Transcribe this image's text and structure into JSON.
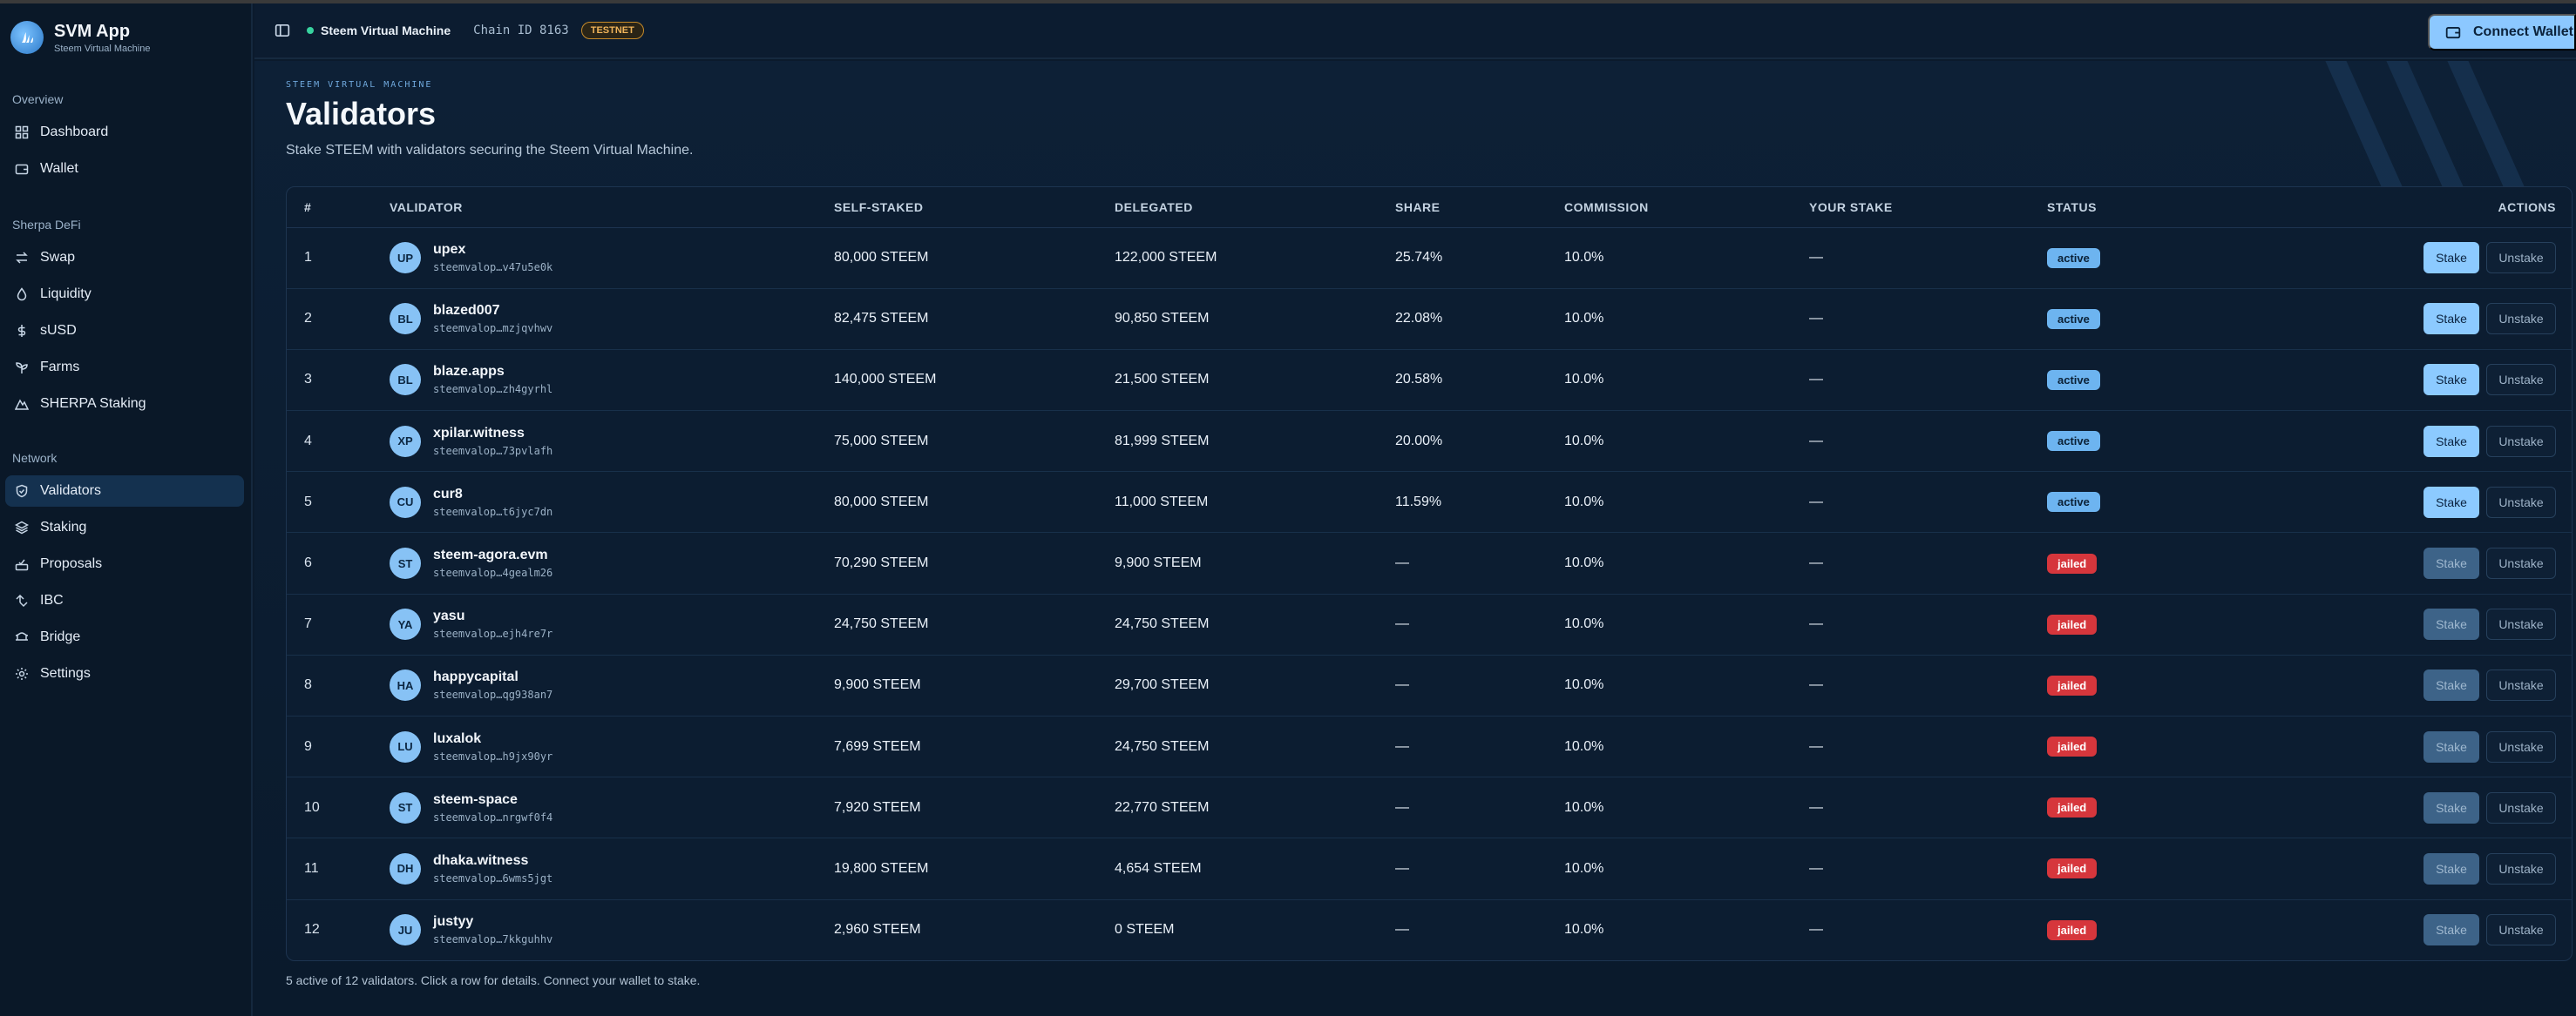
{
  "brand": {
    "title": "SVM App",
    "subtitle": "Steem Virtual Machine"
  },
  "sidebar": {
    "sections": [
      {
        "label": "Overview",
        "items": [
          {
            "label": "Dashboard",
            "icon": "grid-icon"
          },
          {
            "label": "Wallet",
            "icon": "wallet-icon"
          }
        ]
      },
      {
        "label": "Sherpa DeFi",
        "items": [
          {
            "label": "Swap",
            "icon": "swap-icon"
          },
          {
            "label": "Liquidity",
            "icon": "droplet-icon"
          },
          {
            "label": "sUSD",
            "icon": "dollar-icon"
          },
          {
            "label": "Farms",
            "icon": "sprout-icon"
          },
          {
            "label": "SHERPA Staking",
            "icon": "mountain-icon"
          }
        ]
      },
      {
        "label": "Network",
        "items": [
          {
            "label": "Validators",
            "icon": "shield-check-icon",
            "active": true
          },
          {
            "label": "Staking",
            "icon": "layers-icon"
          },
          {
            "label": "Proposals",
            "icon": "vote-icon"
          },
          {
            "label": "IBC",
            "icon": "arrows-icon"
          },
          {
            "label": "Bridge",
            "icon": "bridge-icon"
          },
          {
            "label": "Settings",
            "icon": "gear-icon"
          }
        ]
      }
    ]
  },
  "topbar": {
    "network_name": "Steem Virtual Machine",
    "chain_id": "Chain ID 8163",
    "testnet_badge": "TESTNET",
    "connect_label": "Connect Wallet"
  },
  "page": {
    "eyebrow": "STEEM VIRTUAL MACHINE",
    "title": "Validators",
    "description": "Stake STEEM with validators securing the Steem Virtual Machine.",
    "footer": "5 active of 12 validators. Click a row for details. Connect your wallet to stake."
  },
  "table": {
    "headers": {
      "num": "#",
      "validator": "VALIDATOR",
      "self_staked": "SELF-STAKED",
      "delegated": "DELEGATED",
      "share": "SHARE",
      "commission": "COMMISSION",
      "your_stake": "YOUR STAKE",
      "status": "STATUS",
      "actions": "ACTIONS"
    },
    "stake_label": "Stake",
    "unstake_label": "Unstake",
    "rows": [
      {
        "num": "1",
        "initials": "UP",
        "name": "upex",
        "addr": "steemvalop…v47u5e0k",
        "self": "80,000 STEEM",
        "delegated": "122,000 STEEM",
        "share": "25.74%",
        "commission": "10.0%",
        "your": "—",
        "status": "active"
      },
      {
        "num": "2",
        "initials": "BL",
        "name": "blazed007",
        "addr": "steemvalop…mzjqvhwv",
        "self": "82,475 STEEM",
        "delegated": "90,850 STEEM",
        "share": "22.08%",
        "commission": "10.0%",
        "your": "—",
        "status": "active"
      },
      {
        "num": "3",
        "initials": "BL",
        "name": "blaze.apps",
        "addr": "steemvalop…zh4gyrhl",
        "self": "140,000 STEEM",
        "delegated": "21,500 STEEM",
        "share": "20.58%",
        "commission": "10.0%",
        "your": "—",
        "status": "active"
      },
      {
        "num": "4",
        "initials": "XP",
        "name": "xpilar.witness",
        "addr": "steemvalop…73pvlafh",
        "self": "75,000 STEEM",
        "delegated": "81,999 STEEM",
        "share": "20.00%",
        "commission": "10.0%",
        "your": "—",
        "status": "active"
      },
      {
        "num": "5",
        "initials": "CU",
        "name": "cur8",
        "addr": "steemvalop…t6jyc7dn",
        "self": "80,000 STEEM",
        "delegated": "11,000 STEEM",
        "share": "11.59%",
        "commission": "10.0%",
        "your": "—",
        "status": "active"
      },
      {
        "num": "6",
        "initials": "ST",
        "name": "steem-agora.evm",
        "addr": "steemvalop…4gealm26",
        "self": "70,290 STEEM",
        "delegated": "9,900 STEEM",
        "share": "—",
        "commission": "10.0%",
        "your": "—",
        "status": "jailed"
      },
      {
        "num": "7",
        "initials": "YA",
        "name": "yasu",
        "addr": "steemvalop…ejh4re7r",
        "self": "24,750 STEEM",
        "delegated": "24,750 STEEM",
        "share": "—",
        "commission": "10.0%",
        "your": "—",
        "status": "jailed"
      },
      {
        "num": "8",
        "initials": "HA",
        "name": "happycapital",
        "addr": "steemvalop…qg938an7",
        "self": "9,900 STEEM",
        "delegated": "29,700 STEEM",
        "share": "—",
        "commission": "10.0%",
        "your": "—",
        "status": "jailed"
      },
      {
        "num": "9",
        "initials": "LU",
        "name": "luxalok",
        "addr": "steemvalop…h9jx90yr",
        "self": "7,699 STEEM",
        "delegated": "24,750 STEEM",
        "share": "—",
        "commission": "10.0%",
        "your": "—",
        "status": "jailed"
      },
      {
        "num": "10",
        "initials": "ST",
        "name": "steem-space",
        "addr": "steemvalop…nrgwf0f4",
        "self": "7,920 STEEM",
        "delegated": "22,770 STEEM",
        "share": "—",
        "commission": "10.0%",
        "your": "—",
        "status": "jailed"
      },
      {
        "num": "11",
        "initials": "DH",
        "name": "dhaka.witness",
        "addr": "steemvalop…6wms5jgt",
        "self": "19,800 STEEM",
        "delegated": "4,654 STEEM",
        "share": "—",
        "commission": "10.0%",
        "your": "—",
        "status": "jailed"
      },
      {
        "num": "12",
        "initials": "JU",
        "name": "justyy",
        "addr": "steemvalop…7kkguhhv",
        "self": "2,960 STEEM",
        "delegated": "0 STEEM",
        "share": "—",
        "commission": "10.0%",
        "your": "—",
        "status": "jailed"
      }
    ]
  }
}
